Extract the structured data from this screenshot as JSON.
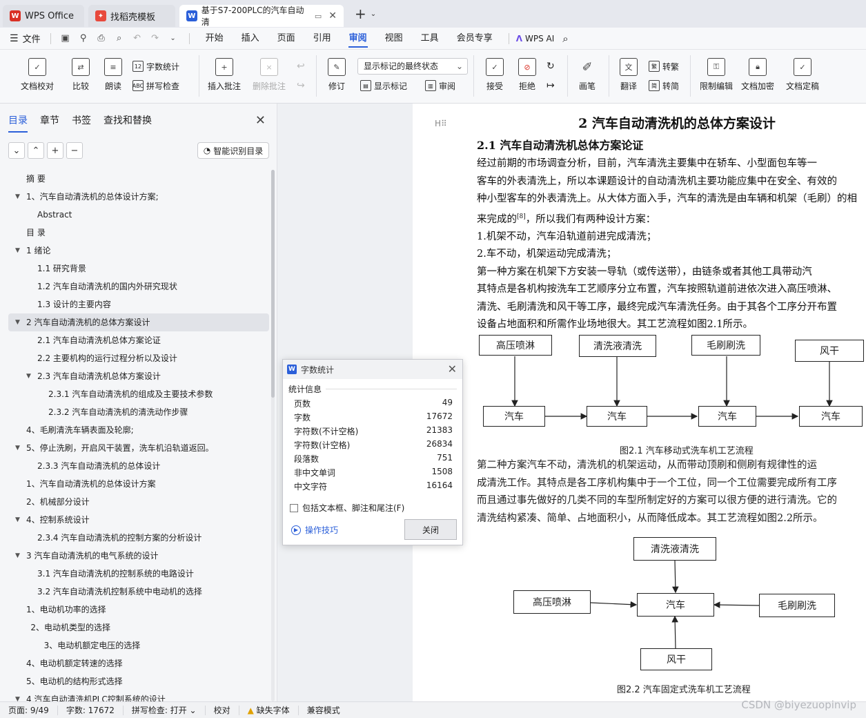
{
  "tabs": [
    {
      "label": "WPS Office",
      "color": "#d93025",
      "glyph": "W"
    },
    {
      "label": "找稻壳模板",
      "color": "#e8493c",
      "glyph": "✦"
    },
    {
      "label": "基于S7-200PLC的汽车自动清",
      "color": "#2b5fd9",
      "glyph": "W"
    }
  ],
  "menu": {
    "file": "文件",
    "items": [
      "开始",
      "插入",
      "页面",
      "引用",
      "审阅",
      "视图",
      "工具",
      "会员专享"
    ],
    "ai": "WPS AI"
  },
  "ribbon": {
    "check": "文档校对",
    "compare": "比较",
    "read": "朗读",
    "wordcount": "字数统计",
    "spell": "拼写检查",
    "insert_comment": "插入批注",
    "delete_comment": "删除批注",
    "revise": "修订",
    "markup_state": "显示标记的最终状态",
    "show_markup": "显示标记",
    "review": "审阅",
    "accept": "接受",
    "reject": "拒绝",
    "pen": "画笔",
    "translate": "翻译",
    "to_trad": "转繁",
    "to_simp": "转简",
    "restrict": "限制编辑",
    "encrypt": "文档加密",
    "finalize": "文档定稿"
  },
  "nav": {
    "tabs": [
      "目录",
      "章节",
      "书签",
      "查找和替换"
    ],
    "smart_label": "智能识别目录",
    "toc": [
      {
        "label": "摘    要",
        "indent": 0,
        "caret": false
      },
      {
        "label": "1、汽车自动清洗机的总体设计方案;",
        "indent": 0,
        "caret": true
      },
      {
        "label": "Abstract",
        "indent": 1,
        "caret": false
      },
      {
        "label": "目    录",
        "indent": 0,
        "caret": false
      },
      {
        "label": "1  绪论",
        "indent": 0,
        "caret": true
      },
      {
        "label": "1.1  研究背景",
        "indent": 1,
        "caret": false
      },
      {
        "label": "1.2  汽车自动清洗机的国内外研究现状",
        "indent": 1,
        "caret": false
      },
      {
        "label": "1.3  设计的主要内容",
        "indent": 1,
        "caret": false
      },
      {
        "label": "2  汽车自动清洗机的总体方案设计",
        "indent": 0,
        "caret": true,
        "selected": true
      },
      {
        "label": "2.1  汽车自动清洗机总体方案论证",
        "indent": 1,
        "caret": false
      },
      {
        "label": "2.2  主要机构的运行过程分析以及设计",
        "indent": 1,
        "caret": false
      },
      {
        "label": "2.3  汽车自动清洗机总体方案设计",
        "indent": 1,
        "caret": true
      },
      {
        "label": "2.3.1  汽车自动清洗机的组成及主要技术参数",
        "indent": 2,
        "caret": false
      },
      {
        "label": "2.3.2  汽车自动清洗机的清洗动作步骤",
        "indent": 2,
        "caret": false
      },
      {
        "label": "4、毛刷清洗车辆表面及轮廓;",
        "indent": 0,
        "caret": false
      },
      {
        "label": "5、停止洗刷，开启风干装置，洗车机沿轨道返回。",
        "indent": 0,
        "caret": true
      },
      {
        "label": "2.3.3  汽车自动清洗机的总体设计",
        "indent": 1,
        "caret": false
      },
      {
        "label": "1、汽车自动清洗机的总体设计方案",
        "indent": 0,
        "caret": false
      },
      {
        "label": "2、机械部分设计",
        "indent": 0,
        "caret": false
      },
      {
        "label": "4、控制系统设计",
        "indent": 0,
        "caret": true
      },
      {
        "label": "2.3.4  汽车自动清洗机的控制方案的分析设计",
        "indent": 1,
        "caret": false
      },
      {
        "label": "3  汽车自动清洗机的电气系统的设计",
        "indent": 0,
        "caret": true
      },
      {
        "label": "3.1  汽车自动清洗机的控制系统的电路设计",
        "indent": 1,
        "caret": false
      },
      {
        "label": "3.2  汽车自动清洗机控制系统中电动机的选择",
        "indent": 1,
        "caret": false
      },
      {
        "label": "1、电动机功率的选择",
        "indent": 0,
        "caret": false
      },
      {
        "label": "2、电动机类型的选择",
        "indent": 0.4,
        "caret": false
      },
      {
        "label": "3、电动机额定电压的选择",
        "indent": 1.6,
        "caret": false
      },
      {
        "label": "4、电动机额定转速的选择",
        "indent": 0,
        "caret": false
      },
      {
        "label": "5、电动机的结构形式选择",
        "indent": 0,
        "caret": false
      },
      {
        "label": "4  汽车自动清洗机PLC控制系统的设计",
        "indent": 0,
        "caret": true
      }
    ]
  },
  "doc": {
    "h2": "2  汽车自动清洗机的总体方案设计",
    "h3": "2.1  汽车自动清洗机总体方案论证",
    "para1": [
      "        经过前期的市场调查分析，目前，汽车清洗主要集中在轿车、小型面包车等一",
      "客车的外表清洗上，所以本课题设计的自动清洗机主要功能应集中在安全、有效的",
      "种小型客车的外表清洗上。从大体方面入手，汽车的清洗是由车辆和机架（毛刷）的相",
      "来完成的",
      "        1.机架不动，汽车沿轨道前进完成清洗；",
      "        2.车不动，机架运动完成清洗；",
      "        第一种方案在机架下方安装一导轨（或传送带），由链条或者其他工具带动汽",
      "其特点是各机构按洗车工艺顺序分立布置，汽车按照轨道前进依次进入高压喷淋、",
      "清洗、毛刷清洗和风干等工序，最终完成汽车清洗任务。由于其各个工序分开布置",
      "设备占地面积和所需作业场地很大。其工艺流程如图2.1所示。"
    ],
    "ref": "[8]",
    "para1_tail": "，所以我们有两种设计方案：",
    "fig1": {
      "top": [
        "高压喷淋",
        "清洗液清洗",
        "毛刷刷洗",
        "风干"
      ],
      "bottom": [
        "汽车",
        "汽车",
        "汽车",
        "汽车"
      ],
      "caption": "图2.1  汽车移动式洗车机工艺流程"
    },
    "para2": [
      "        第二种方案汽车不动，清洗机的机架运动，从而带动顶刷和侧刷有规律性的运",
      "成清洗工作。其特点是各工序机构集中于一个工位，同一个工位需要完成所有工序",
      "而且通过事先做好的几类不同的车型所制定好的方案可以很方便的进行清洗。它的",
      "清洗结构紧凑、简单、占地面积小，从而降低成本。其工艺流程如图2.2所示。"
    ],
    "fig2": {
      "top": "清洗液清洗",
      "left": "高压喷淋",
      "center": "汽车",
      "right": "毛刷刷洗",
      "bottom": "风干",
      "caption": "图2.2    汽车固定式洗车机工艺流程"
    }
  },
  "dialog": {
    "title": "字数统计",
    "section": "统计信息",
    "rows": [
      {
        "k": "页数",
        "v": "49"
      },
      {
        "k": "字数",
        "v": "17672"
      },
      {
        "k": "字符数(不计空格)",
        "v": "21383"
      },
      {
        "k": "字符数(计空格)",
        "v": "26834"
      },
      {
        "k": "段落数",
        "v": "751"
      },
      {
        "k": "非中文单词",
        "v": "1508"
      },
      {
        "k": "中文字符",
        "v": "16164"
      }
    ],
    "checkbox": "包括文本框、脚注和尾注(F)",
    "tips": "操作技巧",
    "close": "关闭"
  },
  "status": {
    "page": "页面: 9/49",
    "words": "字数: 17672",
    "spell": "拼写检查: 打开",
    "proof": "校对",
    "font": "缺失字体",
    "compat": "兼容模式"
  },
  "watermark": "CSDN @biyezuopinvip"
}
